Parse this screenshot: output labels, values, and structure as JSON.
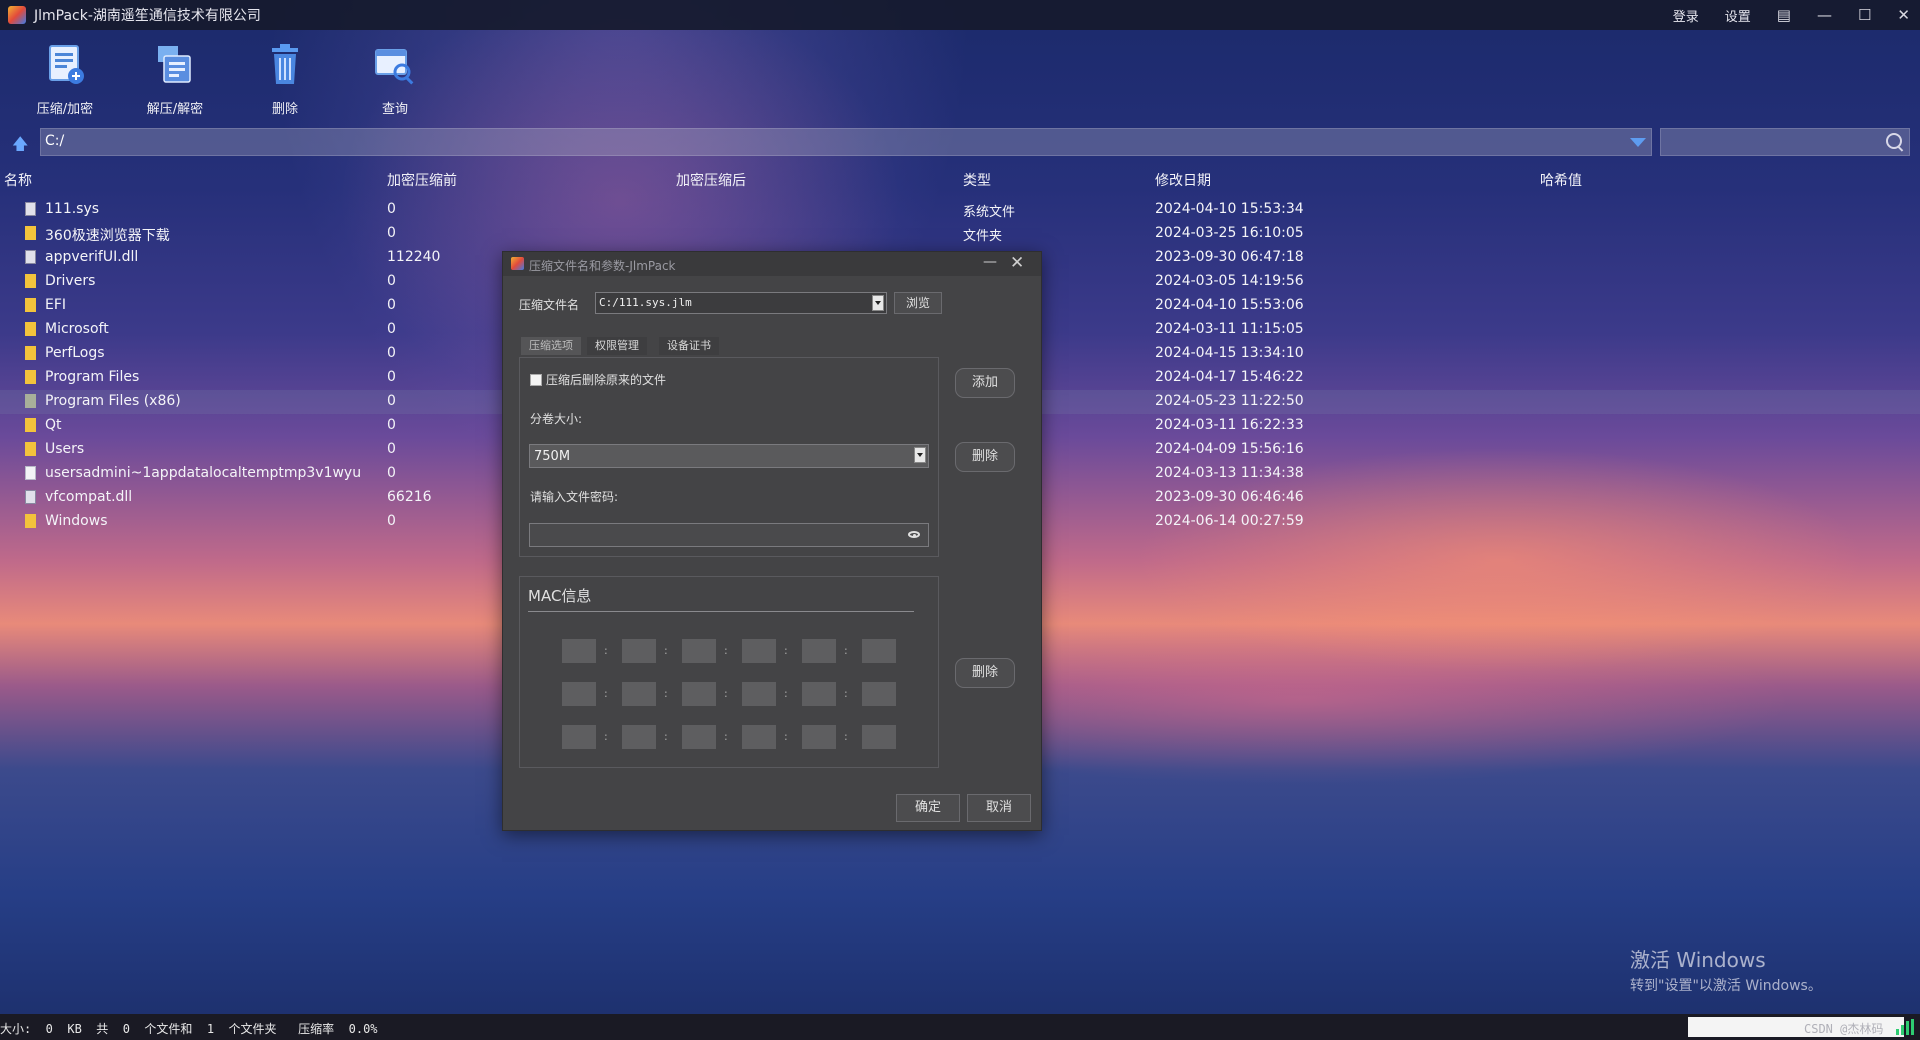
{
  "window": {
    "title": "JlmPack-湖南遥笙通信技术有限公司",
    "login": "登录",
    "settings": "设置"
  },
  "toolbar": {
    "compress": "压缩/加密",
    "extract": "解压/解密",
    "delete": "删除",
    "query": "查询"
  },
  "path": {
    "value": "C:/"
  },
  "table": {
    "headers": {
      "name": "名称",
      "before": "加密压缩前",
      "after": "加密压缩后",
      "type": "类型",
      "modified": "修改日期",
      "hash": "哈希值"
    },
    "rows": [
      {
        "name": "111.sys",
        "size": "0",
        "type": "系统文件",
        "date": "2024-04-10 15:53:34",
        "icon": "sys-file-icon"
      },
      {
        "name": "360极速浏览器下载",
        "size": "0",
        "type": "文件夹",
        "date": "2024-03-25 16:10:05",
        "icon": "folder-icon"
      },
      {
        "name": "appverifUI.dll",
        "size": "112240",
        "type": "",
        "date": "2023-09-30 06:47:18",
        "icon": "dll-file-icon"
      },
      {
        "name": "Drivers",
        "size": "0",
        "type": "",
        "date": "2024-03-05 14:19:56",
        "icon": "folder-icon"
      },
      {
        "name": "EFI",
        "size": "0",
        "type": "",
        "date": "2024-04-10 15:53:06",
        "icon": "folder-icon"
      },
      {
        "name": "Microsoft",
        "size": "0",
        "type": "",
        "date": "2024-03-11 11:15:05",
        "icon": "folder-icon"
      },
      {
        "name": "PerfLogs",
        "size": "0",
        "type": "",
        "date": "2024-04-15 13:34:10",
        "icon": "folder-icon"
      },
      {
        "name": "Program Files",
        "size": "0",
        "type": "",
        "date": "2024-04-17 15:46:22",
        "icon": "folder-icon"
      },
      {
        "name": "Program Files (x86)",
        "size": "0",
        "type": "",
        "date": "2024-05-23 11:22:50",
        "icon": "folder-gray-icon"
      },
      {
        "name": "Qt",
        "size": "0",
        "type": "",
        "date": "2024-03-11 16:22:33",
        "icon": "folder-icon"
      },
      {
        "name": "Users",
        "size": "0",
        "type": "",
        "date": "2024-04-09 15:56:16",
        "icon": "folder-icon"
      },
      {
        "name": "usersadmini~1appdatalocaltemptmp3v1wyu",
        "size": "0",
        "type": "",
        "date": "2024-03-13 11:34:38",
        "icon": "file-icon"
      },
      {
        "name": "vfcompat.dll",
        "size": "66216",
        "type": "",
        "date": "2023-09-30 06:46:46",
        "icon": "dll-file-icon"
      },
      {
        "name": "Windows",
        "size": "0",
        "type": "",
        "date": "2024-06-14 00:27:59",
        "icon": "folder-icon"
      }
    ]
  },
  "status": {
    "text": "大小:  0  KB  共  0  个文件和  1  个文件夹   压缩率  0.0%",
    "csdn": "CSDN @杰林码"
  },
  "watermark": {
    "line1": "激活 Windows",
    "line2": "转到\"设置\"以激活 Windows。"
  },
  "dialog": {
    "title": "压缩文件名和参数-JlmPack",
    "file_label": "压缩文件名",
    "file_value": "C:/111.sys.jlm",
    "browse": "浏览",
    "tabs": [
      "压缩选项",
      "权限管理",
      "设备证书"
    ],
    "delete_after_label": "压缩后删除原来的文件",
    "volume_label": "分卷大小:",
    "volume_value": "750M",
    "password_label": "请输入文件密码:",
    "add": "添加",
    "delete1": "删除",
    "delete2": "删除",
    "mac_title": "MAC信息",
    "ok": "确定",
    "cancel": "取消"
  },
  "colors": {
    "folder": "#f3c33c",
    "accent": "#5e9cf0",
    "dialog_bg": "#444446"
  }
}
